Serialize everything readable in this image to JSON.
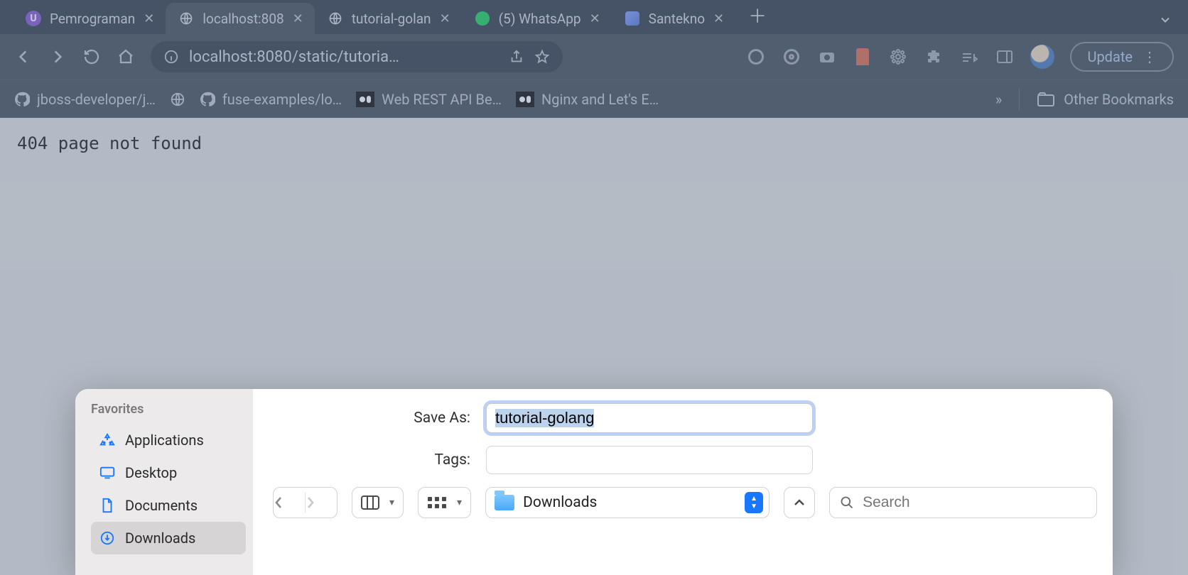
{
  "tabs": [
    {
      "title": "Pemrograman",
      "favicon": "U"
    },
    {
      "title": "localhost:808",
      "favicon": "globe",
      "active": true
    },
    {
      "title": "tutorial-golan",
      "favicon": "globe"
    },
    {
      "title": "(5) WhatsApp",
      "favicon": "whatsapp"
    },
    {
      "title": "Santekno",
      "favicon": "santekno"
    }
  ],
  "url": "localhost:8080/static/tutoria…",
  "update_label": "Update",
  "bookmarks": [
    {
      "label": "jboss-developer/j…",
      "icon": "github"
    },
    {
      "label": "",
      "icon": "globe-gray"
    },
    {
      "label": "fuse-examples/lo…",
      "icon": "github"
    },
    {
      "label": "Web REST API Be…",
      "icon": "medium"
    },
    {
      "label": "Nginx and Let's E…",
      "icon": "medium"
    }
  ],
  "bookmarks_overflow": "»",
  "other_bookmarks_label": "Other Bookmarks",
  "page_text": "404 page not found",
  "dialog": {
    "favorites_header": "Favorites",
    "sidebar": [
      {
        "label": "Applications",
        "icon": "apps"
      },
      {
        "label": "Desktop",
        "icon": "desktop"
      },
      {
        "label": "Documents",
        "icon": "doc"
      },
      {
        "label": "Downloads",
        "icon": "download",
        "active": true
      }
    ],
    "save_as_label": "Save As:",
    "save_as_value": "tutorial-golang",
    "tags_label": "Tags:",
    "tags_value": "",
    "location_label": "Downloads",
    "search_placeholder": "Search"
  }
}
